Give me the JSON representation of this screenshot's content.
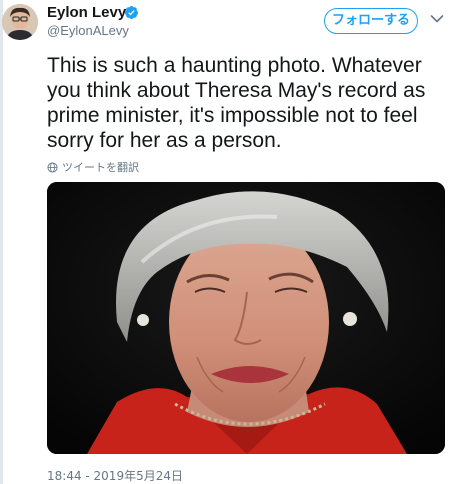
{
  "tweet": {
    "author": {
      "display_name": "Eylon Levy",
      "username": "@EylonALevy",
      "verified": true,
      "avatar_icon": "avatar"
    },
    "follow_label": "フォローする",
    "text": "This is such a haunting photo. Whatever you think about Theresa May's record as prime minister, it's impossible not to feel sorry for her as a person.",
    "translate_label": "ツイートを翻訳",
    "timestamp": "18:44 - 2019年5月24日"
  },
  "colors": {
    "accent": "#1da1f2",
    "text": "#14171a",
    "secondary_text": "#657786"
  },
  "icons": {
    "verified": "verified-badge-icon",
    "more": "chevron-down-icon",
    "translate": "globe-icon"
  }
}
